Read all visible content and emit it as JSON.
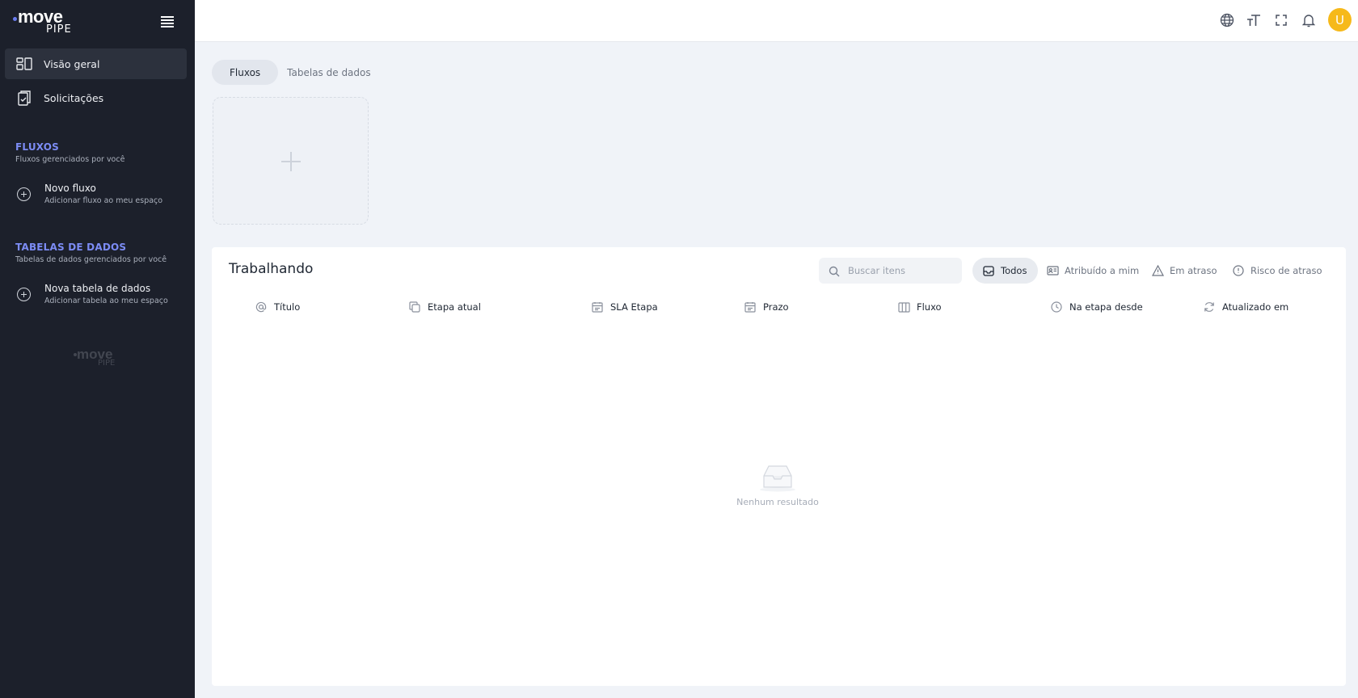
{
  "brand": {
    "logo_top": "move",
    "logo_bottom": "PIPE",
    "accent": "#7c8cf5"
  },
  "sidebar": {
    "nav": [
      {
        "label": "Visão geral",
        "icon": "dashboard-icon",
        "active": true
      },
      {
        "label": "Solicitações",
        "icon": "clipboard-icon",
        "active": false
      }
    ],
    "sections": [
      {
        "title": "FLUXOS",
        "subtitle": "Fluxos gerenciados por você",
        "action_title": "Novo fluxo",
        "action_subtitle": "Adicionar fluxo ao meu espaço"
      },
      {
        "title": "TABELAS DE DADOS",
        "subtitle": "Tabelas de dados gerenciados por você",
        "action_title": "Nova tabela de dados",
        "action_subtitle": "Adicionar tabela ao meu espaço"
      }
    ]
  },
  "topbar": {
    "icons": [
      "globe-icon",
      "text-size-icon",
      "fullscreen-icon",
      "bell-icon"
    ],
    "avatar_letter": "U",
    "avatar_color": "#f6b91a"
  },
  "main": {
    "tabs": [
      {
        "label": "Fluxos",
        "active": true
      },
      {
        "label": "Tabelas de dados",
        "active": false
      }
    ],
    "panel": {
      "title": "Trabalhando",
      "search_placeholder": "Buscar itens",
      "filters": [
        {
          "label": "Todos",
          "icon": "inbox-icon",
          "active": true
        },
        {
          "label": "Atribuído a mim",
          "icon": "id-card-icon",
          "active": false
        },
        {
          "label": "Em atraso",
          "icon": "warning-icon",
          "active": false
        },
        {
          "label": "Risco de atraso",
          "icon": "alert-circle-icon",
          "active": false
        }
      ],
      "columns": [
        {
          "label": "Título",
          "icon": "at-icon"
        },
        {
          "label": "Etapa atual",
          "icon": "copy-icon"
        },
        {
          "label": "SLA Etapa",
          "icon": "calendar-icon"
        },
        {
          "label": "Prazo",
          "icon": "calendar-icon"
        },
        {
          "label": "Fluxo",
          "icon": "columns-icon"
        },
        {
          "label": "Na etapa desde",
          "icon": "clock-icon"
        },
        {
          "label": "Atualizado em",
          "icon": "refresh-icon"
        }
      ],
      "empty_text": "Nenhum resultado"
    }
  }
}
